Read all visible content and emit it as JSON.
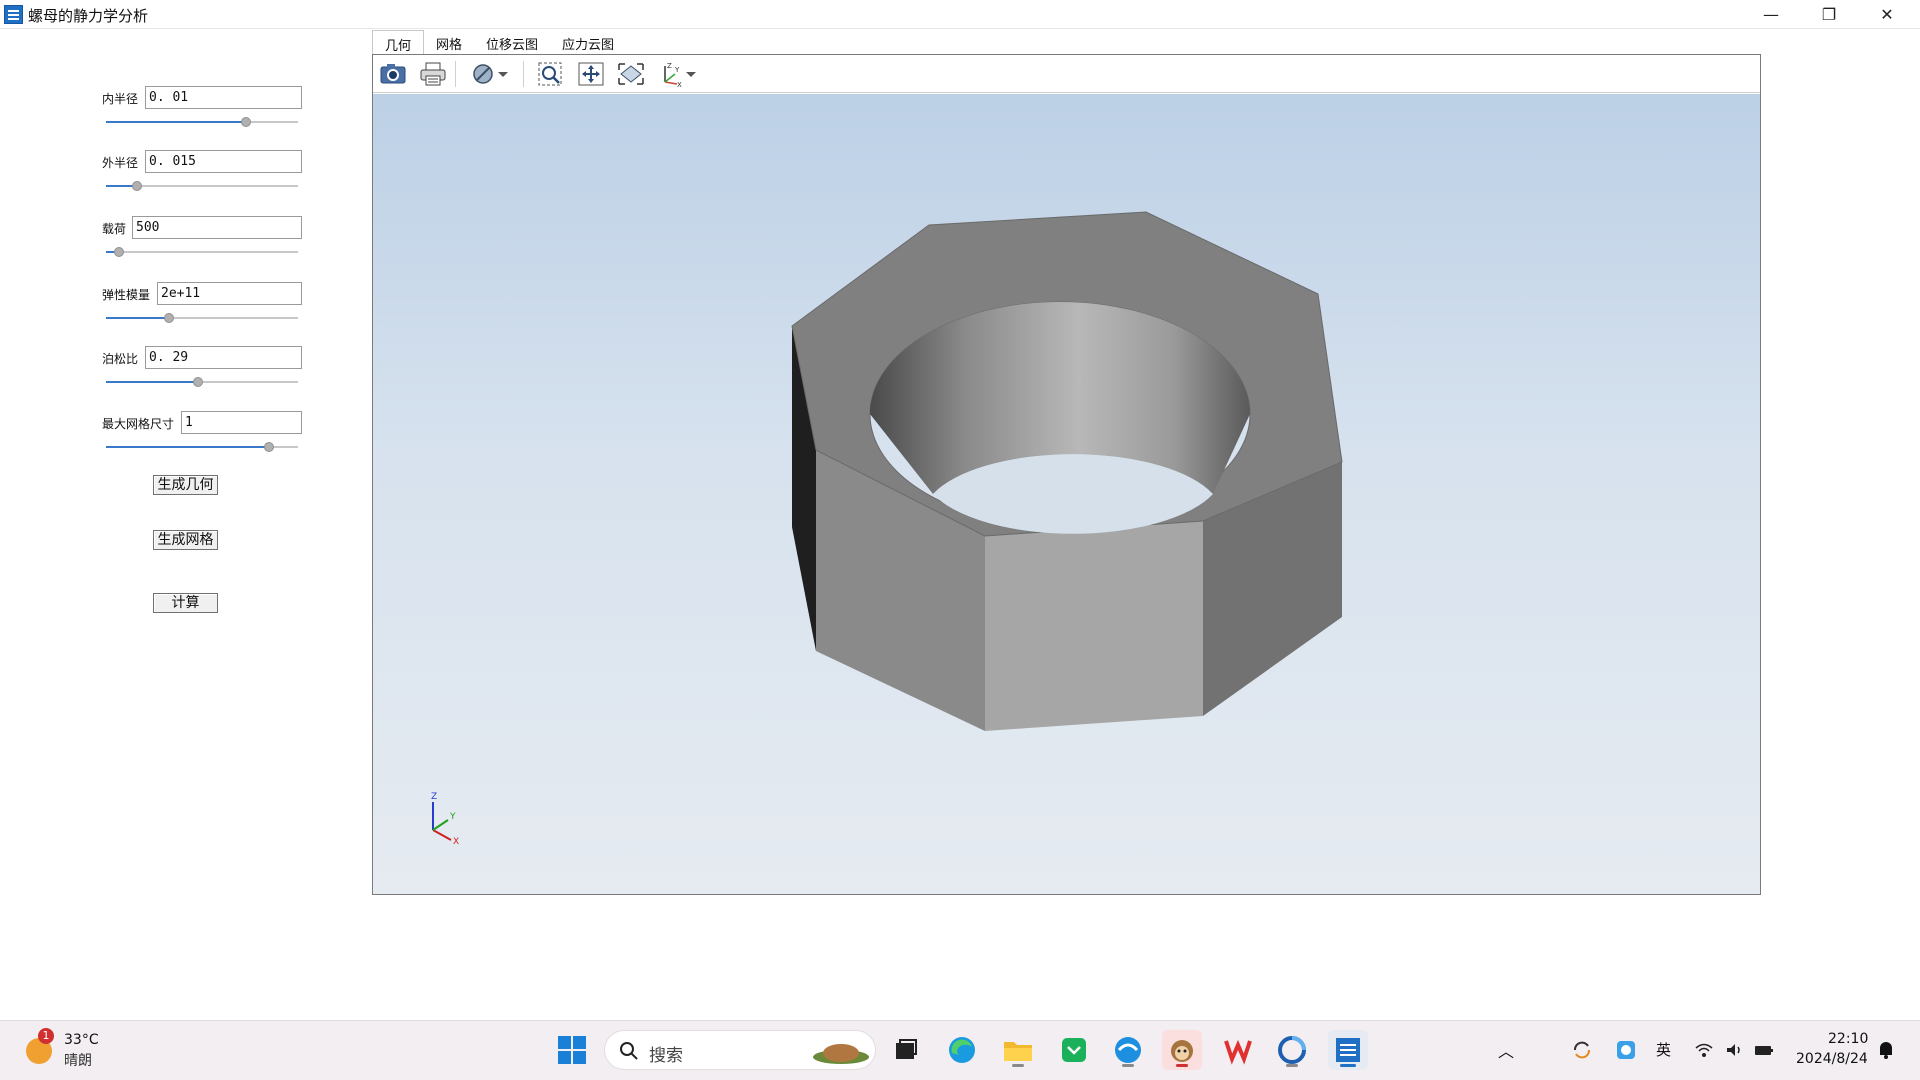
{
  "window": {
    "title": "螺母的静力学分析",
    "minimize_glyph": "—",
    "maximize_glyph": "❐",
    "close_glyph": "✕"
  },
  "params": [
    {
      "label": "内半径",
      "value": "0. 01",
      "slider_fraction": 0.73
    },
    {
      "label": "外半径",
      "value": "0. 015",
      "slider_fraction": 0.16
    },
    {
      "label": "载荷",
      "value": "500",
      "slider_fraction": 0.07
    },
    {
      "label": "弹性模量",
      "value": "2e+11",
      "slider_fraction": 0.33
    },
    {
      "label": "泊松比",
      "value": "0. 29",
      "slider_fraction": 0.48
    },
    {
      "label": "最大网格尺寸",
      "value": "1",
      "slider_fraction": 0.85
    }
  ],
  "buttons": {
    "generate_geometry": "生成几何",
    "generate_mesh": "生成网格",
    "compute": "计算"
  },
  "tabs": [
    "几何",
    "网格",
    "位移云图",
    "应力云图"
  ],
  "active_tab": 0,
  "toolbar": {
    "icons": [
      "camera-icon",
      "print-icon",
      "display-mode-icon",
      "dropdown-arrow-icon",
      "zoom-box-icon",
      "pan-icon",
      "fit-all-icon",
      "view-axes-icon",
      "dropdown-arrow-icon"
    ]
  },
  "viewport": {
    "axes_labels": {
      "x": "X",
      "y": "Y",
      "z": "Z"
    },
    "colors": {
      "bg_top": "#bcd0e6",
      "bg_bottom": "#e6ebf1",
      "nut": "#808080"
    }
  },
  "taskbar": {
    "weather": {
      "temp": "33°C",
      "desc": "晴朗",
      "badge": "1"
    },
    "search_placeholder": "搜索",
    "apps": [
      "start-icon",
      "task-view-icon",
      "edge-icon",
      "file-explorer-icon",
      "wechat-icon",
      "browser-icon",
      "monkey-app-icon",
      "wps-icon",
      "swirl-app-icon",
      "active-app-icon"
    ],
    "tray": {
      "ime": "英",
      "time": "22:10",
      "date": "2024/8/24"
    }
  }
}
